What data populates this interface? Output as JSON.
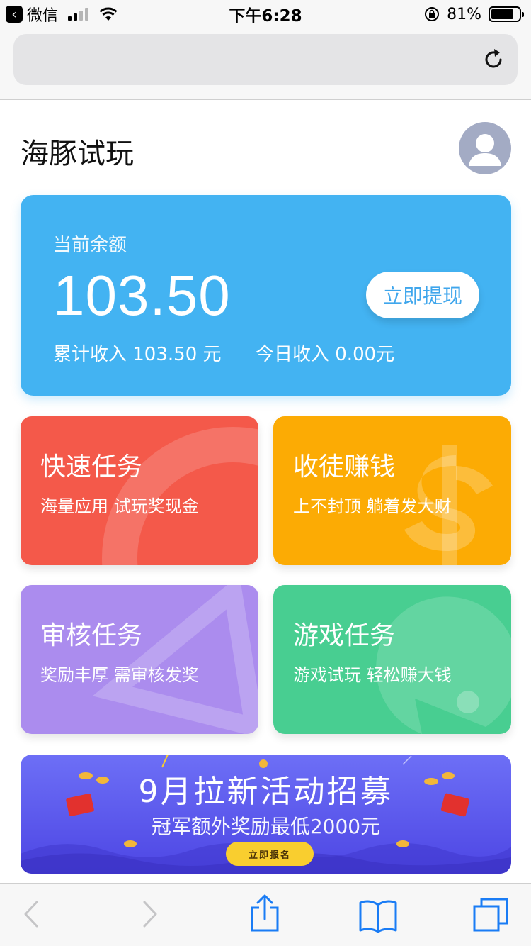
{
  "status_bar": {
    "carrier_back": "微信",
    "time": "下午6:28",
    "battery": "81%",
    "battery_level": 0.81
  },
  "browser": {
    "reload_icon": "reload-icon"
  },
  "header": {
    "title": "海豚试玩",
    "avatar_icon": "user-avatar-icon"
  },
  "balance": {
    "label": "当前余额",
    "amount": "103.50",
    "withdraw_label": "立即提现",
    "total_income": "累计收入 103.50 元",
    "today_income": "今日收入 0.00元"
  },
  "tasks": [
    {
      "title": "快速任务",
      "subtitle": "海量应用 试玩奖现金",
      "color": "#f4594a"
    },
    {
      "title": "收徒赚钱",
      "subtitle": "上不封顶 躺着发大财",
      "color": "#fcab04"
    },
    {
      "title": "审核任务",
      "subtitle": "奖励丰厚 需审核发奖",
      "color": "#ab8cee"
    },
    {
      "title": "游戏任务",
      "subtitle": "游戏试玩 轻松赚大钱",
      "color": "#48ce91"
    }
  ],
  "banner": {
    "title": "9月拉新活动招募",
    "subtitle": "冠军额外奖励最低2000元",
    "button_label": "立即报名"
  },
  "toolbar": {
    "icons": [
      "back-arrow-icon",
      "forward-arrow-icon",
      "share-icon",
      "bookmarks-icon",
      "tabs-icon"
    ]
  },
  "colors": {
    "balance_card": "#43b3f2",
    "banner": "#5a56ee"
  }
}
